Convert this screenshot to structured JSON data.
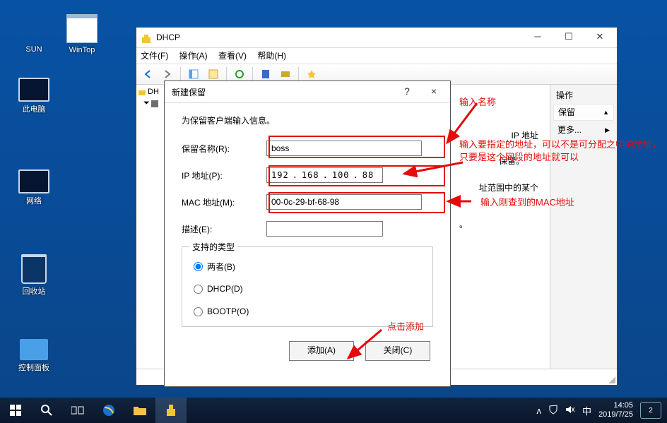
{
  "desktop": {
    "icons": {
      "sun": "SUN",
      "wintop": "WinTop",
      "this_pc": "此电脑",
      "network": "网络",
      "recycle": "回收站",
      "control_panel": "控制面板"
    }
  },
  "dhcp_window": {
    "title": "DHCP",
    "menu": {
      "file": "文件(F)",
      "action": "操作(A)",
      "view": "查看(V)",
      "help": "帮助(H)"
    },
    "tree": {
      "root_short": "DH",
      "indent_glyph": "⏷"
    },
    "center_labels": {
      "ip_address": "IP 地址",
      "reserve": "保留。",
      "scope_some": "址范围中的某个",
      "period": "。"
    },
    "actions_pane": {
      "title": "操作",
      "reserve": "保留",
      "reserve_arrow": "▲",
      "more": "更多...",
      "more_arrow": "▶"
    }
  },
  "dialog": {
    "title": "新建保留",
    "help_btn": "?",
    "close_btn": "×",
    "info": "为保留客户端输入信息。",
    "labels": {
      "name": "保留名称(R):",
      "ip": "IP 地址(P):",
      "mac": "MAC 地址(M):",
      "desc": "描述(E):",
      "types": "支持的类型"
    },
    "values": {
      "name": "boss",
      "ip_octets": [
        "192",
        "168",
        "100",
        "88"
      ],
      "mac": "00-0c-29-bf-68-98",
      "desc": ""
    },
    "radios": {
      "both": "两者(B)",
      "dhcp": "DHCP(D)",
      "bootp": "BOOTP(O)",
      "selected": "both"
    },
    "buttons": {
      "add": "添加(A)",
      "close": "关闭(C)"
    }
  },
  "annotations": {
    "name_hint": "输入名称",
    "ip_hint": "输入要指定的地址，可以不是可分配之中的地址，只要是这个网段的地址就可以",
    "mac_hint": "输入刚查到的MAC地址",
    "add_hint": "点击添加"
  },
  "taskbar": {
    "clock_time": "14:05",
    "clock_date": "2019/7/25",
    "lang": "中",
    "balloon_count": "2"
  }
}
